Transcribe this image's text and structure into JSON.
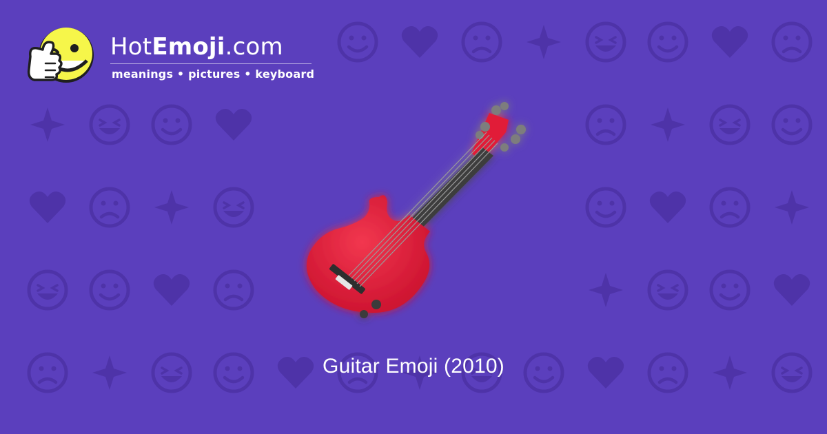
{
  "site": {
    "brand_prefix": "Hot",
    "brand_strong": "Emoji",
    "brand_suffix": ".com",
    "tagline": "meanings • pictures • keyboard"
  },
  "emoji": {
    "name": "Guitar",
    "caption": "Guitar Emoji (2010)"
  },
  "colors": {
    "background": "#5b3fbd",
    "pattern": "#4e33a8",
    "guitar_body": "#e11d38",
    "logo_face": "#f6f64a"
  },
  "background_icons": [
    "broken-heart-icon",
    "slightly-smiling-face-icon",
    "persevering-face-icon",
    "ok-hand-icon",
    "expressionless-face-icon",
    "eyes-icon",
    "relieved-face-icon",
    "recycling-icon",
    "raising-hands-icon",
    "musical-notes-icon",
    "see-no-evil-monkey-icon",
    "victory-hand-icon",
    "sparkles-icon",
    "heart-icon",
    "confused-face-icon",
    "tongue-face-icon",
    "frowning-face-icon",
    "raised-hands-icon",
    "heart-arrow-icon",
    "two-hearts-icon",
    "crying-face-icon",
    "smiling-imp-icon",
    "left-arrow-icon",
    "fire-icon",
    "oncoming-fist-icon",
    "party-popper-icon",
    "rose-icon",
    "sun-icon",
    "flexed-biceps-icon",
    "check-mark-icon",
    "heart-eyes-cat-icon",
    "camera-icon",
    "kissing-face-icon"
  ]
}
